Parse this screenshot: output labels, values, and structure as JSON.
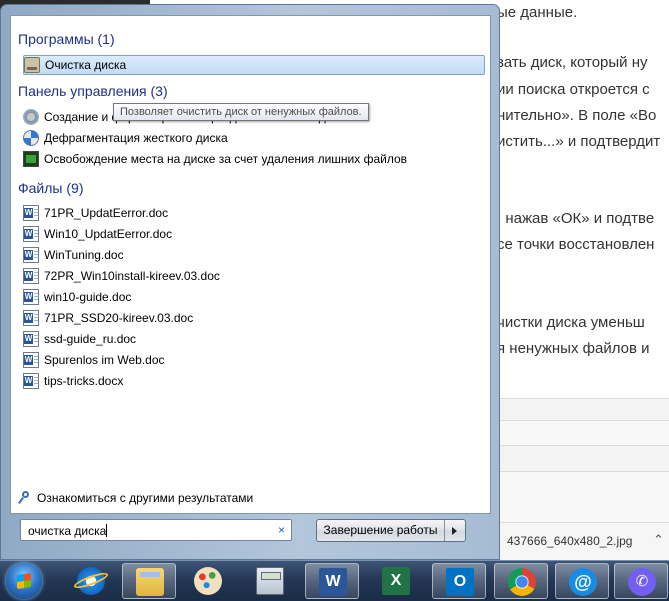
{
  "background": {
    "lines": [
      "ые данные.",
      "зать диск, который ну",
      "ии поиска откроется с",
      "нительно». В поле «Во",
      "истить...» и подтвердит",
      ", нажав «ОК» и подтве",
      "се точки восстановлен",
      "чистки диска уменьш",
      "я ненужных файлов и"
    ],
    "file_name": "437666_640x480_2.jpg"
  },
  "start_menu": {
    "programs": {
      "title": "Программы (1)",
      "items": [
        {
          "label": "Очистка диска",
          "icon": "disk-cleanup-icon",
          "selected": true
        }
      ]
    },
    "control_panel": {
      "title": "Панель управления (3)",
      "items": [
        {
          "label": "Создание и форматирование разделов жесткого диска",
          "icon": "partition-icon"
        },
        {
          "label": "Дефрагментация жесткого диска",
          "icon": "defrag-icon"
        },
        {
          "label": "Освобождение места на диске за счет удаления лишних файлов",
          "icon": "free-space-icon"
        }
      ]
    },
    "files": {
      "title": "Файлы (9)",
      "items": [
        {
          "label": "71PR_UpdatEerror.doc",
          "icon": "word-doc-icon"
        },
        {
          "label": "Win10_UpdatEerror.doc",
          "icon": "word-doc-icon"
        },
        {
          "label": "WinTuning.doc",
          "icon": "word-doc-icon"
        },
        {
          "label": "72PR_Win10install-kireev.03.doc",
          "icon": "word-doc-icon"
        },
        {
          "label": "win10-guide.doc",
          "icon": "word-doc-icon"
        },
        {
          "label": "71PR_SSD20-kireev.03.doc",
          "icon": "word-doc-icon"
        },
        {
          "label": "ssd-guide_ru.doc",
          "icon": "word-doc-icon"
        },
        {
          "label": "Spurenlos im Web.doc",
          "icon": "word-doc-icon"
        },
        {
          "label": "tips-tricks.docx",
          "icon": "word-doc-icon"
        }
      ]
    },
    "tooltip": "Позволяет очистить диск от ненужных файлов.",
    "more_results": "Ознакомиться с другими результатами",
    "search": {
      "value": "очистка диска",
      "clear_icon": "×"
    },
    "shutdown_label": "Завершение работы"
  },
  "taskbar": {
    "apps": [
      "internet-explorer",
      "windows-explorer",
      "paint",
      "calculator",
      "word",
      "excel",
      "outlook",
      "chrome",
      "mail-agent",
      "viber"
    ],
    "word_letter": "W",
    "excel_letter": "X",
    "outlook_letter": "O",
    "mail_symbol": "@",
    "viber_symbol": "✆"
  }
}
